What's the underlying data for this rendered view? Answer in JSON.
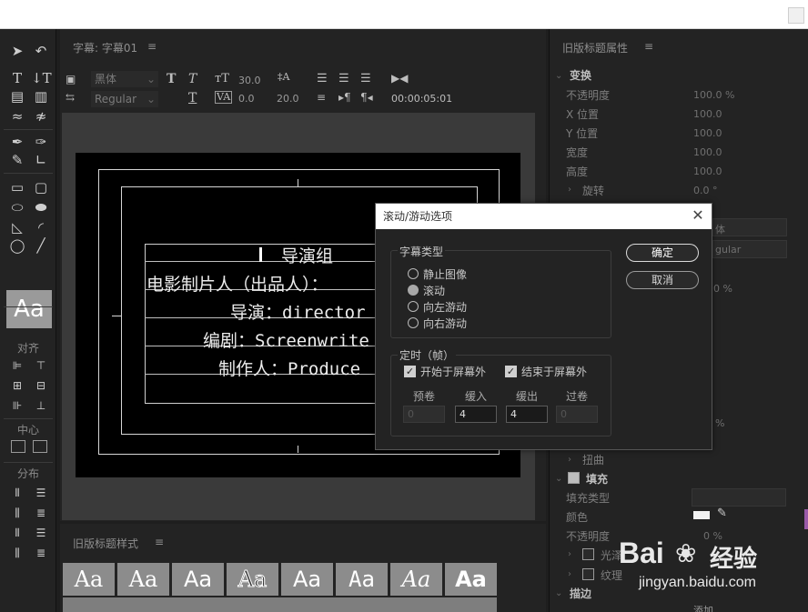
{
  "main_panel": {
    "title": "字幕: 字幕01",
    "menu_glyph": "≡"
  },
  "toolbar": {
    "font_family": "黑体",
    "font_style": "Regular",
    "font_size": "30.0",
    "kerning": "0.0",
    "leading": "20.0",
    "timecode": "00:00:05:01"
  },
  "canvas": {
    "credits": [
      "导演组",
      "电影制片人（出品人）：",
      "导演：director",
      "编剧：Screenwrite",
      "制作人：Produce"
    ]
  },
  "left_tools": {
    "align_label": "对齐",
    "center_label": "中心",
    "distribute_label": "分布",
    "style_preview": "Aa"
  },
  "style_panel": {
    "title": "旧版标题样式",
    "menu_glyph": "≡",
    "swatches": [
      "Aa",
      "Aa",
      "Aa",
      "Aa",
      "Aa",
      "Aa",
      "Aa",
      "Aa"
    ]
  },
  "right_panel": {
    "title": "旧版标题属性",
    "menu_glyph": "≡",
    "transform_head": "变换",
    "opacity_label": "不透明度",
    "opacity_val": "100.0 %",
    "x_label": "X 位置",
    "x_val": "100.0",
    "y_label": "Y 位置",
    "y_val": "100.0",
    "width_label": "宽度",
    "width_val": "100.0",
    "height_label": "高度",
    "height_val": "100.0",
    "rotation_label": "旋转",
    "rotation_val": "0.0 °",
    "font_partial": "体",
    "style_partial": "gular",
    "pct_partial_1": "0 %",
    "pct_partial_2": "%",
    "distort_label": "扭曲",
    "fill_head": "填充",
    "fill_type_label": "填充类型",
    "color_label": "颜色",
    "fill_opacity_label": "不透明度",
    "fill_opacity_val": "0 %",
    "sheen_label": "光泽",
    "texture_label": "纹理",
    "stroke_head": "描边",
    "bottom_partial": "添加"
  },
  "dialog": {
    "title": "滚动/游动选项",
    "close_glyph": "✕",
    "type_group": "字幕类型",
    "options": [
      "静止图像",
      "滚动",
      "向左游动",
      "向右游动"
    ],
    "selected_index": 1,
    "ok_label": "确定",
    "cancel_label": "取消",
    "timing_group": "定时（帧）",
    "start_off_screen": "开始于屏幕外",
    "end_off_screen": "结束于屏幕外",
    "preroll_label": "预卷",
    "ease_in_label": "缓入",
    "ease_out_label": "缓出",
    "postroll_label": "过卷",
    "preroll_val": "0",
    "ease_in_val": "4",
    "ease_out_val": "4",
    "postroll_val": "0"
  },
  "watermark": {
    "brand": "Bai",
    "brand2": "经验",
    "url": "jingyan.baidu.com"
  }
}
